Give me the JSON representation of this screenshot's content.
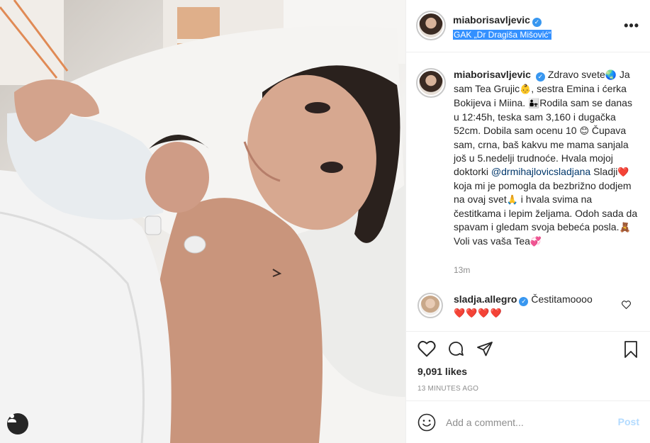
{
  "post": {
    "username": "miaborisavljevic",
    "location": "GAK „Dr Dragiša Mišović“",
    "more_label": "•••"
  },
  "caption": {
    "username": "miaborisavljevic",
    "text_1": "Zdravo svete",
    "emoji_1": "🌏",
    "text_2": " Ja sam Tea Grujic",
    "emoji_2": "👶",
    "text_3": ", sestra Emina i ćerka Bokijeva i Miina. ",
    "emoji_3": "👨‍👧",
    "text_4": "Rodila sam se danas u 12:45h, teska sam 3,160 i dugačka 52cm. Dobila sam ocenu 10 ",
    "emoji_4": "😊",
    "text_5": " Čupava sam, crna, baš kakvu me mama sanjala još u 5.nedelji trudnoće. Hvala mojoj doktorki ",
    "mention": "@drmihajlovicsladjana",
    "text_6": " Sladji",
    "emoji_6": "❤️",
    "text_7": " koja mi je pomogla da bezbrižno dodjem na ovaj svet",
    "emoji_7": "🙏",
    "text_8": " i hvala svima na čestitkama i lepim željama. Odoh sada da spavam i gledam svoja bebeća posla.",
    "emoji_8": "🧸",
    "text_9": " Voli vas vaša Tea",
    "emoji_9": "💞",
    "ago": "13m"
  },
  "comment": {
    "username": "sladja.allegro",
    "text": "Čestitamoooo",
    "hearts": "❤️❤️❤️❤️"
  },
  "stats": {
    "likes": "9,091 likes",
    "time": "13 MINUTES AGO"
  },
  "comment_bar": {
    "placeholder": "Add a comment...",
    "post_label": "Post"
  },
  "colors": {
    "verified": "#3897f0",
    "location_highlight": "#3390ff",
    "mention": "#00376b",
    "post_disabled": "#b3dbff"
  },
  "icons": [
    "verified-icon",
    "more-icon",
    "heart-icon",
    "comment-icon",
    "share-icon",
    "bookmark-icon",
    "emoji-icon",
    "user-tag-icon"
  ]
}
